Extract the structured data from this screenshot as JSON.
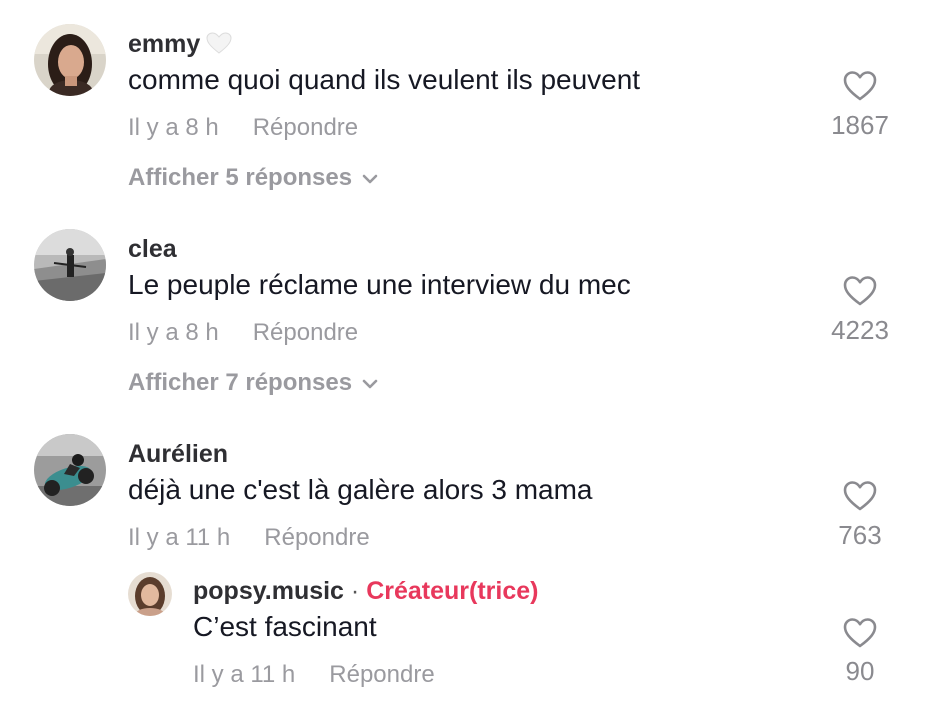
{
  "comments": [
    {
      "username": "emmy",
      "username_emoji": "white-heart",
      "text": "comme quoi quand ils veulent ils peuvent",
      "time": "Il y a 8 h",
      "reply_label": "Répondre",
      "likes": "1867",
      "view_replies": "Afficher 5 réponses"
    },
    {
      "username": "clea",
      "text": "Le peuple réclame une interview du mec",
      "time": "Il y a 8 h",
      "reply_label": "Répondre",
      "likes": "4223",
      "view_replies": "Afficher 7 réponses"
    },
    {
      "username": "Aurélien",
      "text": "déjà une c'est là galère alors 3 mama",
      "time": "Il y a 11 h",
      "reply_label": "Répondre",
      "likes": "763"
    }
  ],
  "reply": {
    "username": "popsy.music",
    "separator": "·",
    "badge": "Créateur(trice)",
    "text": "C’est fascinant",
    "time": "Il y a 11 h",
    "reply_label": "Répondre",
    "likes": "90"
  },
  "colors": {
    "creator_badge": "#e8385c",
    "muted_text": "#9a9a9f",
    "primary_text": "#161823"
  },
  "icons": {
    "like": "heart-outline-icon",
    "expand": "chevron-down-icon"
  }
}
